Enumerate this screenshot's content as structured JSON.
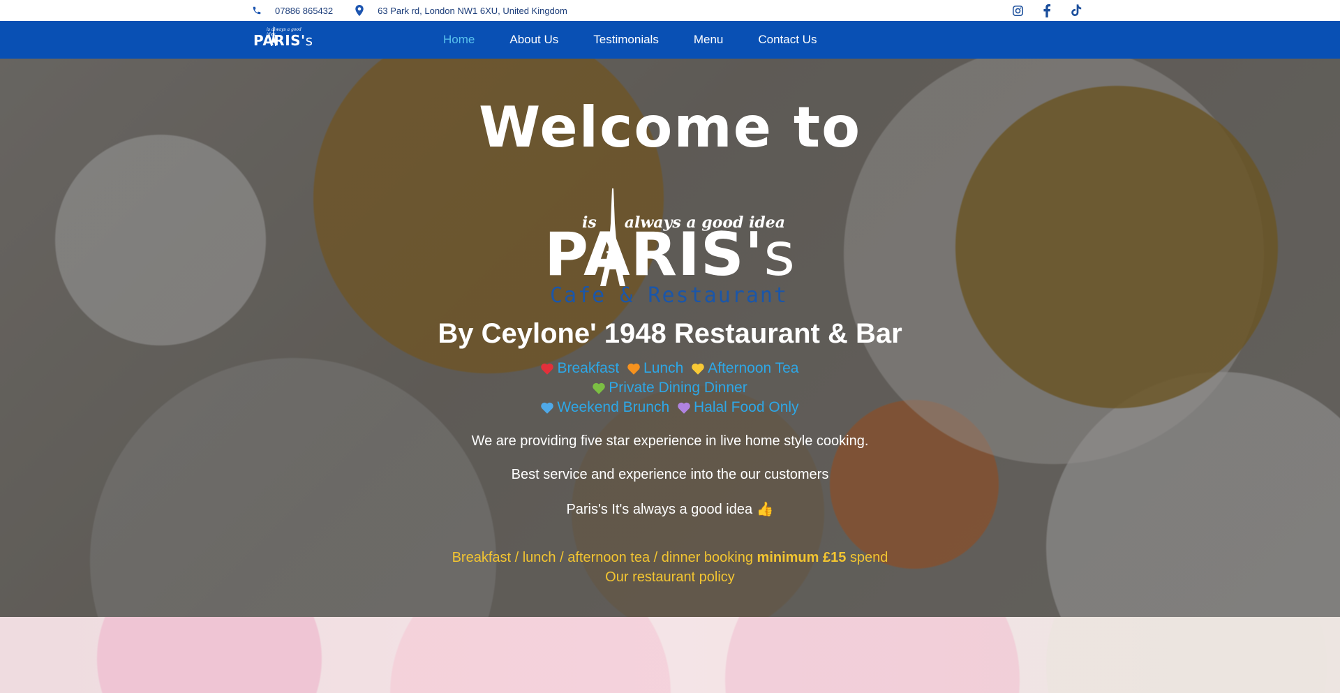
{
  "topbar": {
    "phone": "07886 865432",
    "address": "63 Park rd, London NW1 6XU, United Kingdom",
    "icons": [
      "phone-icon",
      "map-pin-icon"
    ],
    "socials": [
      "instagram-icon",
      "facebook-icon",
      "tiktok-icon"
    ]
  },
  "nav": {
    "logo_tagline": "is always a good idea",
    "logo_name": "PARIS'",
    "logo_suffix": "s",
    "items": [
      {
        "label": "Home",
        "active": true
      },
      {
        "label": "About Us"
      },
      {
        "label": "Testimonials"
      },
      {
        "label": "Menu"
      },
      {
        "label": "Contact Us"
      }
    ]
  },
  "hero": {
    "welcome": "Welcome to",
    "logo": {
      "tag_left": "is",
      "tag_right": "always a good idea",
      "name": "PARIS'",
      "name_suffix": "s",
      "sub": "Cafe & Restaurant"
    },
    "subtitle": "By Ceylone' 1948 Restaurant & Bar",
    "services": {
      "breakfast": "Breakfast",
      "lunch": "Lunch",
      "afternoon_tea": "Afternoon Tea",
      "private_dining": "Private Dining Dinner",
      "weekend_brunch": "Weekend Brunch",
      "halal": "Halal Food Only"
    },
    "heart_colors": {
      "red": "#e3303a",
      "orange": "#f6921e",
      "yellow": "#f8c935",
      "green": "#7cbf43",
      "blue": "#4fa9e8",
      "purple": "#b083e0"
    },
    "desc1": "We are providing five star experience in live home style cooking.",
    "desc2": "Best service and experience into the our customers",
    "desc3": "Paris's It's always a good idea 👍",
    "policy_line1_a": "Breakfast / lunch / afternoon tea / dinner booking ",
    "policy_line1_b": "minimum £15",
    "policy_line1_c": " spend",
    "policy_line2": "Our restaurant policy"
  },
  "colors": {
    "nav_bg": "#0950b4",
    "nav_active": "#59c2ee",
    "topbar_text": "#1d3e7a",
    "service_text": "#2ea7e6",
    "policy_text": "#f3c531"
  }
}
